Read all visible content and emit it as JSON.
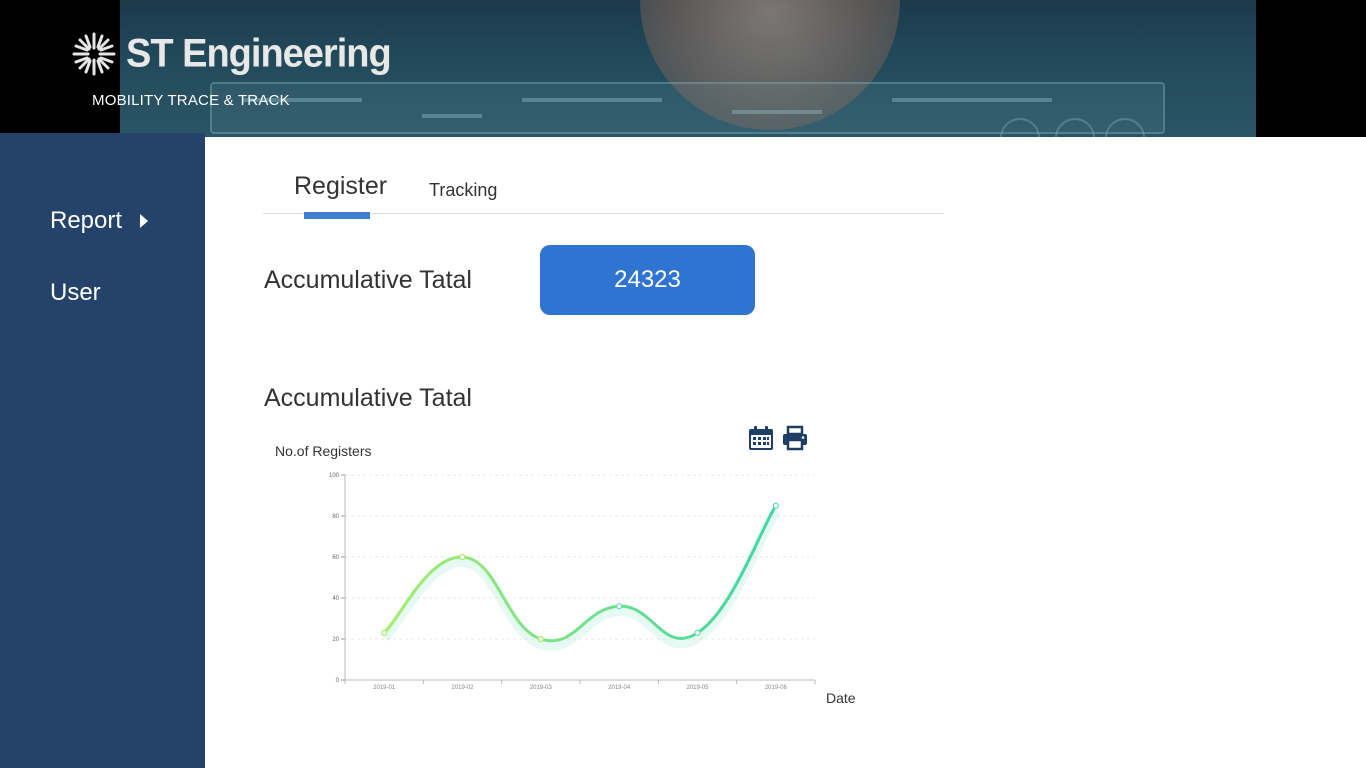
{
  "header": {
    "brand": "ST Engineering",
    "subtitle": "MOBILITY TRACE & TRACK"
  },
  "sidebar": {
    "items": [
      {
        "label": "Report",
        "has_submenu": true
      },
      {
        "label": "User",
        "has_submenu": false
      }
    ]
  },
  "tabs": [
    {
      "label": "Register",
      "active": true
    },
    {
      "label": "Tracking",
      "active": false
    }
  ],
  "summary": {
    "label": "Accumulative Tatal",
    "value": "24323"
  },
  "chart_section": {
    "title": "Accumulative Tatal",
    "icons": [
      "calendar-icon",
      "print-icon"
    ]
  },
  "colors": {
    "sidebar": "#24426a",
    "accent": "#2f74d0",
    "line_start": "#a6ee6a",
    "line_end": "#3ed6a8"
  },
  "chart_data": {
    "type": "line",
    "smooth": true,
    "ylabel": "No.of Registers",
    "xlabel": "Date",
    "categories": [
      "2019-01",
      "2019-02",
      "2019-03",
      "2019-04",
      "2019-05",
      "2019-06"
    ],
    "series": [
      {
        "values": [
          23,
          60,
          20,
          36,
          23,
          85
        ]
      }
    ],
    "ylim": [
      0,
      100
    ],
    "yticks": [
      0,
      20,
      40,
      60,
      80,
      100
    ],
    "grid": true
  }
}
